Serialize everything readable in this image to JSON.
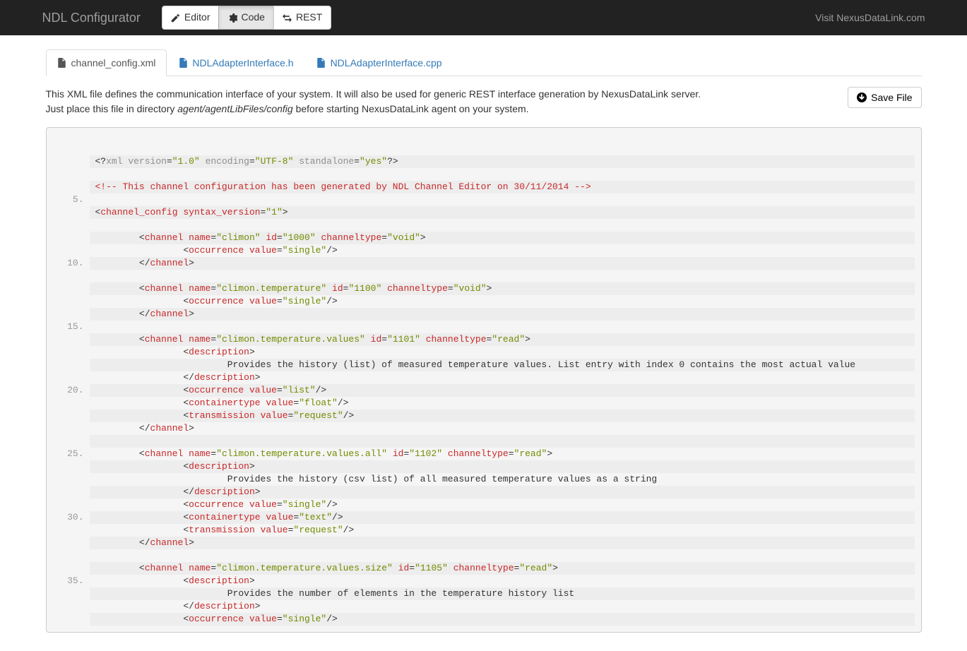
{
  "navbar": {
    "brand": "NDL Configurator",
    "editor_label": "Editor",
    "code_label": "Code",
    "rest_label": "REST",
    "visit_label": "Visit NexusDataLink.com"
  },
  "tabs": [
    {
      "label": "channel_config.xml",
      "active": true
    },
    {
      "label": "NDLAdapterInterface.h",
      "active": false
    },
    {
      "label": "NDLAdapterInterface.cpp",
      "active": false
    }
  ],
  "info": {
    "line1": "This XML file defines the communication interface of your system. It will also be used for generic REST interface generation by NexusDataLink server.",
    "line2a": "Just place this file in directory ",
    "line2em": "agent/agentLibFiles/config",
    "line2b": " before starting NexusDataLink agent on your system."
  },
  "save_label": "Save File",
  "code": {
    "numbered_lines": [
      5,
      10,
      15,
      20,
      25,
      30,
      35
    ],
    "lines": [
      [
        {
          "c": "t-punc",
          "t": "<?"
        },
        {
          "c": "t-pi",
          "t": "xml version"
        },
        {
          "c": "t-punc",
          "t": "="
        },
        {
          "c": "t-str",
          "t": "\"1.0\""
        },
        {
          "c": "t-pi",
          "t": " encoding"
        },
        {
          "c": "t-punc",
          "t": "="
        },
        {
          "c": "t-str",
          "t": "\"UTF-8\""
        },
        {
          "c": "t-pi",
          "t": " standalone"
        },
        {
          "c": "t-punc",
          "t": "="
        },
        {
          "c": "t-str",
          "t": "\"yes\""
        },
        {
          "c": "t-punc",
          "t": "?>"
        }
      ],
      [],
      [
        {
          "c": "t-com",
          "t": "<!-- This channel configuration has been generated by NDL Channel Editor on 30/11/2014 -->"
        }
      ],
      [],
      [
        {
          "c": "t-punc",
          "t": "<"
        },
        {
          "c": "t-tag",
          "t": "channel_config"
        },
        {
          "c": "t-txt",
          "t": " "
        },
        {
          "c": "t-attr",
          "t": "syntax_version"
        },
        {
          "c": "t-punc",
          "t": "="
        },
        {
          "c": "t-str",
          "t": "\"1\""
        },
        {
          "c": "t-punc",
          "t": ">"
        }
      ],
      [],
      [
        {
          "c": "t-txt",
          "t": "        "
        },
        {
          "c": "t-punc",
          "t": "<"
        },
        {
          "c": "t-tag",
          "t": "channel"
        },
        {
          "c": "t-txt",
          "t": " "
        },
        {
          "c": "t-attr",
          "t": "name"
        },
        {
          "c": "t-punc",
          "t": "="
        },
        {
          "c": "t-str",
          "t": "\"climon\""
        },
        {
          "c": "t-txt",
          "t": " "
        },
        {
          "c": "t-attr",
          "t": "id"
        },
        {
          "c": "t-punc",
          "t": "="
        },
        {
          "c": "t-str",
          "t": "\"1000\""
        },
        {
          "c": "t-txt",
          "t": " "
        },
        {
          "c": "t-attr",
          "t": "channeltype"
        },
        {
          "c": "t-punc",
          "t": "="
        },
        {
          "c": "t-str",
          "t": "\"void\""
        },
        {
          "c": "t-punc",
          "t": ">"
        }
      ],
      [
        {
          "c": "t-txt",
          "t": "                "
        },
        {
          "c": "t-punc",
          "t": "<"
        },
        {
          "c": "t-tag",
          "t": "occurrence"
        },
        {
          "c": "t-txt",
          "t": " "
        },
        {
          "c": "t-attr",
          "t": "value"
        },
        {
          "c": "t-punc",
          "t": "="
        },
        {
          "c": "t-str",
          "t": "\"single\""
        },
        {
          "c": "t-punc",
          "t": "/>"
        }
      ],
      [
        {
          "c": "t-txt",
          "t": "        "
        },
        {
          "c": "t-punc",
          "t": "</"
        },
        {
          "c": "t-tag",
          "t": "channel"
        },
        {
          "c": "t-punc",
          "t": ">"
        }
      ],
      [],
      [
        {
          "c": "t-txt",
          "t": "        "
        },
        {
          "c": "t-punc",
          "t": "<"
        },
        {
          "c": "t-tag",
          "t": "channel"
        },
        {
          "c": "t-txt",
          "t": " "
        },
        {
          "c": "t-attr",
          "t": "name"
        },
        {
          "c": "t-punc",
          "t": "="
        },
        {
          "c": "t-str",
          "t": "\"climon.temperature\""
        },
        {
          "c": "t-txt",
          "t": " "
        },
        {
          "c": "t-attr",
          "t": "id"
        },
        {
          "c": "t-punc",
          "t": "="
        },
        {
          "c": "t-str",
          "t": "\"1100\""
        },
        {
          "c": "t-txt",
          "t": " "
        },
        {
          "c": "t-attr",
          "t": "channeltype"
        },
        {
          "c": "t-punc",
          "t": "="
        },
        {
          "c": "t-str",
          "t": "\"void\""
        },
        {
          "c": "t-punc",
          "t": ">"
        }
      ],
      [
        {
          "c": "t-txt",
          "t": "                "
        },
        {
          "c": "t-punc",
          "t": "<"
        },
        {
          "c": "t-tag",
          "t": "occurrence"
        },
        {
          "c": "t-txt",
          "t": " "
        },
        {
          "c": "t-attr",
          "t": "value"
        },
        {
          "c": "t-punc",
          "t": "="
        },
        {
          "c": "t-str",
          "t": "\"single\""
        },
        {
          "c": "t-punc",
          "t": "/>"
        }
      ],
      [
        {
          "c": "t-txt",
          "t": "        "
        },
        {
          "c": "t-punc",
          "t": "</"
        },
        {
          "c": "t-tag",
          "t": "channel"
        },
        {
          "c": "t-punc",
          "t": ">"
        }
      ],
      [],
      [
        {
          "c": "t-txt",
          "t": "        "
        },
        {
          "c": "t-punc",
          "t": "<"
        },
        {
          "c": "t-tag",
          "t": "channel"
        },
        {
          "c": "t-txt",
          "t": " "
        },
        {
          "c": "t-attr",
          "t": "name"
        },
        {
          "c": "t-punc",
          "t": "="
        },
        {
          "c": "t-str",
          "t": "\"climon.temperature.values\""
        },
        {
          "c": "t-txt",
          "t": " "
        },
        {
          "c": "t-attr",
          "t": "id"
        },
        {
          "c": "t-punc",
          "t": "="
        },
        {
          "c": "t-str",
          "t": "\"1101\""
        },
        {
          "c": "t-txt",
          "t": " "
        },
        {
          "c": "t-attr",
          "t": "channeltype"
        },
        {
          "c": "t-punc",
          "t": "="
        },
        {
          "c": "t-str",
          "t": "\"read\""
        },
        {
          "c": "t-punc",
          "t": ">"
        }
      ],
      [
        {
          "c": "t-txt",
          "t": "                "
        },
        {
          "c": "t-punc",
          "t": "<"
        },
        {
          "c": "t-tag",
          "t": "description"
        },
        {
          "c": "t-punc",
          "t": ">"
        }
      ],
      [
        {
          "c": "t-txt",
          "t": "                        Provides the history (list) of measured temperature values. List entry with index 0 contains the most actual value"
        }
      ],
      [
        {
          "c": "t-txt",
          "t": "                "
        },
        {
          "c": "t-punc",
          "t": "</"
        },
        {
          "c": "t-tag",
          "t": "description"
        },
        {
          "c": "t-punc",
          "t": ">"
        }
      ],
      [
        {
          "c": "t-txt",
          "t": "                "
        },
        {
          "c": "t-punc",
          "t": "<"
        },
        {
          "c": "t-tag",
          "t": "occurrence"
        },
        {
          "c": "t-txt",
          "t": " "
        },
        {
          "c": "t-attr",
          "t": "value"
        },
        {
          "c": "t-punc",
          "t": "="
        },
        {
          "c": "t-str",
          "t": "\"list\""
        },
        {
          "c": "t-punc",
          "t": "/>"
        }
      ],
      [
        {
          "c": "t-txt",
          "t": "                "
        },
        {
          "c": "t-punc",
          "t": "<"
        },
        {
          "c": "t-tag",
          "t": "containertype"
        },
        {
          "c": "t-txt",
          "t": " "
        },
        {
          "c": "t-attr",
          "t": "value"
        },
        {
          "c": "t-punc",
          "t": "="
        },
        {
          "c": "t-str",
          "t": "\"float\""
        },
        {
          "c": "t-punc",
          "t": "/>"
        }
      ],
      [
        {
          "c": "t-txt",
          "t": "                "
        },
        {
          "c": "t-punc",
          "t": "<"
        },
        {
          "c": "t-tag",
          "t": "transmission"
        },
        {
          "c": "t-txt",
          "t": " "
        },
        {
          "c": "t-attr",
          "t": "value"
        },
        {
          "c": "t-punc",
          "t": "="
        },
        {
          "c": "t-str",
          "t": "\"request\""
        },
        {
          "c": "t-punc",
          "t": "/>"
        }
      ],
      [
        {
          "c": "t-txt",
          "t": "        "
        },
        {
          "c": "t-punc",
          "t": "</"
        },
        {
          "c": "t-tag",
          "t": "channel"
        },
        {
          "c": "t-punc",
          "t": ">"
        }
      ],
      [],
      [
        {
          "c": "t-txt",
          "t": "        "
        },
        {
          "c": "t-punc",
          "t": "<"
        },
        {
          "c": "t-tag",
          "t": "channel"
        },
        {
          "c": "t-txt",
          "t": " "
        },
        {
          "c": "t-attr",
          "t": "name"
        },
        {
          "c": "t-punc",
          "t": "="
        },
        {
          "c": "t-str",
          "t": "\"climon.temperature.values.all\""
        },
        {
          "c": "t-txt",
          "t": " "
        },
        {
          "c": "t-attr",
          "t": "id"
        },
        {
          "c": "t-punc",
          "t": "="
        },
        {
          "c": "t-str",
          "t": "\"1102\""
        },
        {
          "c": "t-txt",
          "t": " "
        },
        {
          "c": "t-attr",
          "t": "channeltype"
        },
        {
          "c": "t-punc",
          "t": "="
        },
        {
          "c": "t-str",
          "t": "\"read\""
        },
        {
          "c": "t-punc",
          "t": ">"
        }
      ],
      [
        {
          "c": "t-txt",
          "t": "                "
        },
        {
          "c": "t-punc",
          "t": "<"
        },
        {
          "c": "t-tag",
          "t": "description"
        },
        {
          "c": "t-punc",
          "t": ">"
        }
      ],
      [
        {
          "c": "t-txt",
          "t": "                        Provides the history (csv list) of all measured temperature values as a string"
        }
      ],
      [
        {
          "c": "t-txt",
          "t": "                "
        },
        {
          "c": "t-punc",
          "t": "</"
        },
        {
          "c": "t-tag",
          "t": "description"
        },
        {
          "c": "t-punc",
          "t": ">"
        }
      ],
      [
        {
          "c": "t-txt",
          "t": "                "
        },
        {
          "c": "t-punc",
          "t": "<"
        },
        {
          "c": "t-tag",
          "t": "occurrence"
        },
        {
          "c": "t-txt",
          "t": " "
        },
        {
          "c": "t-attr",
          "t": "value"
        },
        {
          "c": "t-punc",
          "t": "="
        },
        {
          "c": "t-str",
          "t": "\"single\""
        },
        {
          "c": "t-punc",
          "t": "/>"
        }
      ],
      [
        {
          "c": "t-txt",
          "t": "                "
        },
        {
          "c": "t-punc",
          "t": "<"
        },
        {
          "c": "t-tag",
          "t": "containertype"
        },
        {
          "c": "t-txt",
          "t": " "
        },
        {
          "c": "t-attr",
          "t": "value"
        },
        {
          "c": "t-punc",
          "t": "="
        },
        {
          "c": "t-str",
          "t": "\"text\""
        },
        {
          "c": "t-punc",
          "t": "/>"
        }
      ],
      [
        {
          "c": "t-txt",
          "t": "                "
        },
        {
          "c": "t-punc",
          "t": "<"
        },
        {
          "c": "t-tag",
          "t": "transmission"
        },
        {
          "c": "t-txt",
          "t": " "
        },
        {
          "c": "t-attr",
          "t": "value"
        },
        {
          "c": "t-punc",
          "t": "="
        },
        {
          "c": "t-str",
          "t": "\"request\""
        },
        {
          "c": "t-punc",
          "t": "/>"
        }
      ],
      [
        {
          "c": "t-txt",
          "t": "        "
        },
        {
          "c": "t-punc",
          "t": "</"
        },
        {
          "c": "t-tag",
          "t": "channel"
        },
        {
          "c": "t-punc",
          "t": ">"
        }
      ],
      [],
      [
        {
          "c": "t-txt",
          "t": "        "
        },
        {
          "c": "t-punc",
          "t": "<"
        },
        {
          "c": "t-tag",
          "t": "channel"
        },
        {
          "c": "t-txt",
          "t": " "
        },
        {
          "c": "t-attr",
          "t": "name"
        },
        {
          "c": "t-punc",
          "t": "="
        },
        {
          "c": "t-str",
          "t": "\"climon.temperature.values.size\""
        },
        {
          "c": "t-txt",
          "t": " "
        },
        {
          "c": "t-attr",
          "t": "id"
        },
        {
          "c": "t-punc",
          "t": "="
        },
        {
          "c": "t-str",
          "t": "\"1105\""
        },
        {
          "c": "t-txt",
          "t": " "
        },
        {
          "c": "t-attr",
          "t": "channeltype"
        },
        {
          "c": "t-punc",
          "t": "="
        },
        {
          "c": "t-str",
          "t": "\"read\""
        },
        {
          "c": "t-punc",
          "t": ">"
        }
      ],
      [
        {
          "c": "t-txt",
          "t": "                "
        },
        {
          "c": "t-punc",
          "t": "<"
        },
        {
          "c": "t-tag",
          "t": "description"
        },
        {
          "c": "t-punc",
          "t": ">"
        }
      ],
      [
        {
          "c": "t-txt",
          "t": "                        Provides the number of elements in the temperature history list"
        }
      ],
      [
        {
          "c": "t-txt",
          "t": "                "
        },
        {
          "c": "t-punc",
          "t": "</"
        },
        {
          "c": "t-tag",
          "t": "description"
        },
        {
          "c": "t-punc",
          "t": ">"
        }
      ],
      [
        {
          "c": "t-txt",
          "t": "                "
        },
        {
          "c": "t-punc",
          "t": "<"
        },
        {
          "c": "t-tag",
          "t": "occurrence"
        },
        {
          "c": "t-txt",
          "t": " "
        },
        {
          "c": "t-attr",
          "t": "value"
        },
        {
          "c": "t-punc",
          "t": "="
        },
        {
          "c": "t-str",
          "t": "\"single\""
        },
        {
          "c": "t-punc",
          "t": "/>"
        }
      ]
    ]
  }
}
